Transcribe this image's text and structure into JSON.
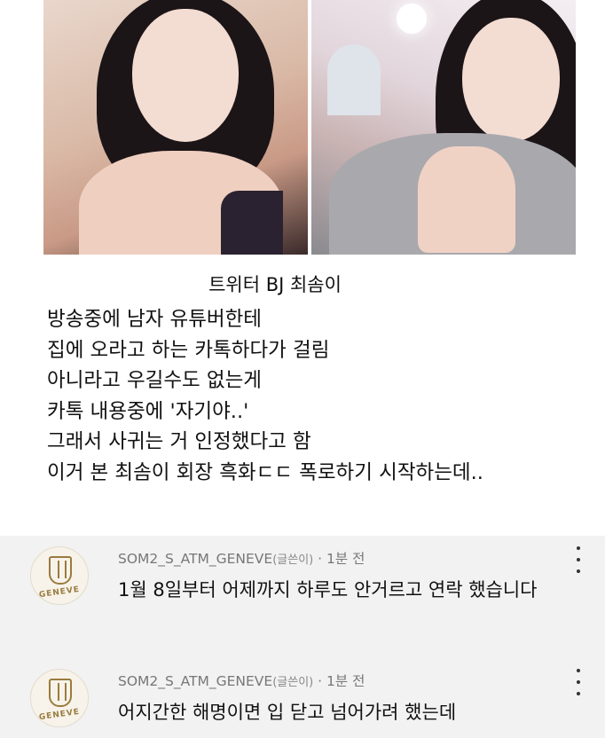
{
  "caption": "트위터 BJ 최솜이",
  "story_lines": [
    "방송중에 남자 유튜버한테",
    "집에 오라고 하는 카톡하다가 걸림",
    "아니라고 우길수도 없는게",
    "카톡 내용중에 '자기야..'",
    "그래서 사귀는 거 인정했다고 함",
    "이거 본 최솜이 회장 흑화ㄷㄷ 폭로하기 시작하는데.."
  ],
  "comments": [
    {
      "author": "SOM2_S_ATM_GENEVE",
      "badge": "(글쓴이)",
      "time": "· 1분 전",
      "avatar_text": "GENEVE",
      "text": "1월 8일부터 어제까지 하루도 안거르고 연락 했습니다"
    },
    {
      "author": "SOM2_S_ATM_GENEVE",
      "badge": "(글쓴이)",
      "time": "· 1분 전",
      "avatar_text": "GENEVE",
      "text": "어지간한 해명이면 입 닫고 넘어가려 했는데"
    }
  ],
  "colors": {
    "comment_bg": "#f2f2f2",
    "meta_text": "#777777",
    "avatar_gold": "#9a7b3e"
  },
  "icons": [
    "more-vertical-icon",
    "geneve-logo"
  ]
}
